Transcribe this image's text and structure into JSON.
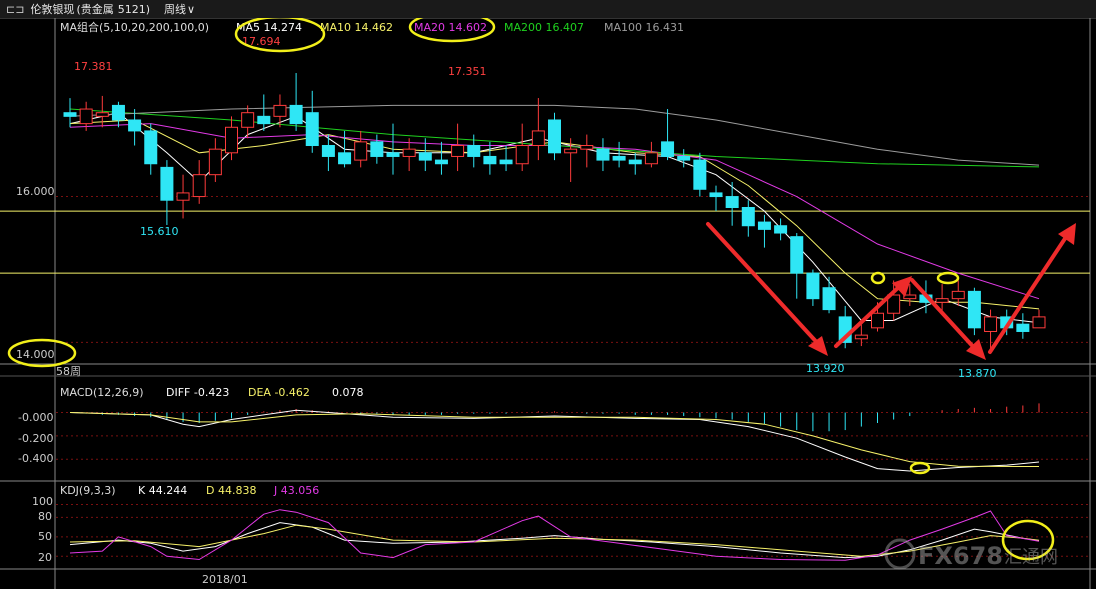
{
  "header": {
    "menu_icon": "menu-icon",
    "title": "伦敦银现",
    "category": "(贵金属",
    "code": "5121)",
    "period": "周线",
    "chevron": "∨"
  },
  "colors": {
    "up": "#ff3b3b",
    "down": "#2fe6f5",
    "ma5": "#ffffff",
    "ma10": "#f7f26a",
    "ma20": "#e23ae6",
    "ma200": "#1fd11f",
    "ma100": "#9c9c9c",
    "grid": "#7a1010",
    "hline": "#f7f26a",
    "annot": "#f2ef1a",
    "arrow": "#ee2b2b"
  },
  "price_panel": {
    "legend": {
      "group": "MA组合(5,10,20,200,100,0)",
      "ma5": "MA5 14.274",
      "ma10": "MA10 14.462",
      "ma20": "MA20 14.602",
      "ma200": "MA200 16.407",
      "ma100": "MA100 16.431"
    },
    "y_ticks": [
      "16.000",
      "14.000"
    ],
    "period_label": "58周",
    "price_labels": [
      {
        "text": "17.381",
        "color": "#ff4040"
      },
      {
        "text": "17.694",
        "color": "#ff4040"
      },
      {
        "text": "17.351",
        "color": "#ff4040"
      },
      {
        "text": "15.610",
        "color": "#2fe6f5"
      },
      {
        "text": "13.920",
        "color": "#2fe6f5"
      },
      {
        "text": "13.870",
        "color": "#2fe6f5"
      }
    ]
  },
  "macd_panel": {
    "legend": {
      "name": "MACD(12,26,9)",
      "diff": "DIFF -0.423",
      "dea": "DEA -0.462",
      "macd": "0.078"
    },
    "y_ticks": [
      "-0.000",
      "-0.200",
      "-0.400"
    ]
  },
  "kdj_panel": {
    "legend": {
      "name": "KDJ(9,3,3)",
      "k": "K 44.244",
      "d": "D 44.838",
      "j": "J 43.056"
    },
    "y_ticks": [
      "100",
      "80",
      "50",
      "20"
    ]
  },
  "x_axis": {
    "date_label": "2018/01"
  },
  "watermark": {
    "brand": "FX678",
    "site": "汇通网"
  },
  "chart_data": {
    "type": "candlestick",
    "title": "伦敦银现 周线",
    "ylim": [
      13.8,
      17.9
    ],
    "hlines": [
      15.8,
      14.95
    ],
    "candles": [
      [
        17.15,
        17.1,
        17.35,
        16.95
      ],
      [
        17.0,
        17.2,
        17.3,
        16.9
      ],
      [
        17.1,
        17.15,
        17.38,
        16.95
      ],
      [
        17.25,
        17.05,
        17.3,
        16.95
      ],
      [
        17.05,
        16.9,
        17.2,
        16.7
      ],
      [
        16.9,
        16.45,
        17.0,
        16.3
      ],
      [
        16.4,
        15.95,
        16.5,
        15.61
      ],
      [
        15.95,
        16.05,
        16.3,
        15.7
      ],
      [
        16.0,
        16.3,
        16.5,
        15.9
      ],
      [
        16.3,
        16.65,
        16.8,
        16.2
      ],
      [
        16.6,
        16.95,
        17.1,
        16.5
      ],
      [
        16.95,
        17.15,
        17.25,
        16.8
      ],
      [
        17.1,
        17.0,
        17.4,
        16.9
      ],
      [
        17.1,
        17.25,
        17.4,
        16.95
      ],
      [
        17.25,
        17.0,
        17.694,
        16.9
      ],
      [
        17.15,
        16.7,
        17.45,
        16.6
      ],
      [
        16.7,
        16.55,
        16.85,
        16.35
      ],
      [
        16.6,
        16.45,
        16.9,
        16.4
      ],
      [
        16.5,
        16.75,
        16.9,
        16.4
      ],
      [
        16.75,
        16.55,
        16.85,
        16.45
      ],
      [
        16.6,
        16.55,
        17.0,
        16.3
      ],
      [
        16.55,
        16.65,
        16.8,
        16.35
      ],
      [
        16.6,
        16.5,
        16.8,
        16.35
      ],
      [
        16.5,
        16.45,
        16.75,
        16.3
      ],
      [
        16.55,
        16.7,
        17.0,
        16.35
      ],
      [
        16.7,
        16.55,
        16.85,
        16.4
      ],
      [
        16.55,
        16.45,
        16.75,
        16.3
      ],
      [
        16.5,
        16.45,
        16.7,
        16.35
      ],
      [
        16.45,
        16.7,
        17.0,
        16.35
      ],
      [
        16.7,
        16.9,
        17.351,
        16.5
      ],
      [
        17.05,
        16.6,
        17.15,
        16.5
      ],
      [
        16.6,
        16.65,
        16.8,
        16.2
      ],
      [
        16.65,
        16.7,
        16.85,
        16.4
      ],
      [
        16.65,
        16.5,
        16.8,
        16.35
      ],
      [
        16.55,
        16.5,
        16.75,
        16.4
      ],
      [
        16.5,
        16.45,
        16.6,
        16.3
      ],
      [
        16.45,
        16.6,
        16.75,
        16.4
      ],
      [
        16.75,
        16.55,
        17.2,
        16.5
      ],
      [
        16.55,
        16.5,
        16.65,
        16.4
      ],
      [
        16.5,
        16.1,
        16.6,
        16.0
      ],
      [
        16.05,
        16.0,
        16.15,
        15.8
      ],
      [
        16.0,
        15.85,
        16.2,
        15.6
      ],
      [
        15.85,
        15.6,
        15.95,
        15.45
      ],
      [
        15.65,
        15.55,
        15.75,
        15.3
      ],
      [
        15.6,
        15.5,
        15.7,
        15.4
      ],
      [
        15.45,
        14.95,
        15.5,
        14.6
      ],
      [
        14.95,
        14.6,
        15.0,
        14.5
      ],
      [
        14.75,
        14.45,
        14.9,
        14.4
      ],
      [
        14.35,
        14.0,
        14.5,
        13.92
      ],
      [
        14.05,
        14.1,
        14.25,
        13.95
      ],
      [
        14.2,
        14.4,
        14.55,
        14.15
      ],
      [
        14.4,
        14.65,
        14.85,
        14.3
      ],
      [
        14.6,
        14.65,
        14.8,
        14.5
      ],
      [
        14.65,
        14.55,
        14.85,
        14.4
      ],
      [
        14.55,
        14.6,
        14.8,
        14.4
      ],
      [
        14.6,
        14.7,
        14.85,
        14.5
      ],
      [
        14.7,
        14.2,
        14.75,
        14.1
      ],
      [
        14.15,
        14.35,
        14.45,
        13.87
      ],
      [
        14.35,
        14.2,
        14.45,
        14.1
      ],
      [
        14.25,
        14.15,
        14.4,
        14.05
      ],
      [
        14.2,
        14.35,
        14.45,
        14.2
      ]
    ],
    "ma": {
      "MA5": [
        [
          0,
          17.0
        ],
        [
          3,
          17.15
        ],
        [
          6,
          16.6
        ],
        [
          8,
          16.2
        ],
        [
          11,
          16.85
        ],
        [
          14,
          17.1
        ],
        [
          17,
          16.65
        ],
        [
          20,
          16.6
        ],
        [
          25,
          16.6
        ],
        [
          29,
          16.8
        ],
        [
          33,
          16.6
        ],
        [
          37,
          16.55
        ],
        [
          40,
          16.3
        ],
        [
          43,
          15.8
        ],
        [
          46,
          15.1
        ],
        [
          49,
          14.3
        ],
        [
          51,
          14.3
        ],
        [
          54,
          14.6
        ],
        [
          57,
          14.35
        ],
        [
          60,
          14.27
        ]
      ],
      "MA10": [
        [
          0,
          17.0
        ],
        [
          4,
          17.05
        ],
        [
          8,
          16.6
        ],
        [
          12,
          16.7
        ],
        [
          16,
          16.85
        ],
        [
          20,
          16.65
        ],
        [
          25,
          16.6
        ],
        [
          30,
          16.75
        ],
        [
          35,
          16.6
        ],
        [
          39,
          16.55
        ],
        [
          42,
          16.15
        ],
        [
          45,
          15.6
        ],
        [
          48,
          14.95
        ],
        [
          50,
          14.6
        ],
        [
          53,
          14.55
        ],
        [
          56,
          14.55
        ],
        [
          60,
          14.46
        ]
      ],
      "MA20": [
        [
          0,
          16.95
        ],
        [
          5,
          17.0
        ],
        [
          10,
          16.8
        ],
        [
          15,
          16.85
        ],
        [
          20,
          16.75
        ],
        [
          25,
          16.7
        ],
        [
          30,
          16.7
        ],
        [
          35,
          16.65
        ],
        [
          40,
          16.5
        ],
        [
          45,
          16.0
        ],
        [
          50,
          15.35
        ],
        [
          55,
          14.95
        ],
        [
          60,
          14.6
        ]
      ],
      "MA200": [
        [
          0,
          17.2
        ],
        [
          10,
          17.05
        ],
        [
          20,
          16.85
        ],
        [
          30,
          16.7
        ],
        [
          40,
          16.55
        ],
        [
          50,
          16.45
        ],
        [
          60,
          16.407
        ]
      ],
      "MA100": [
        [
          0,
          17.1
        ],
        [
          10,
          17.2
        ],
        [
          20,
          17.25
        ],
        [
          30,
          17.25
        ],
        [
          35,
          17.2
        ],
        [
          40,
          17.05
        ],
        [
          45,
          16.85
        ],
        [
          50,
          16.65
        ],
        [
          55,
          16.5
        ],
        [
          60,
          16.431
        ]
      ]
    },
    "macd": {
      "ylim": [
        -0.56,
        0.09
      ],
      "diff": [
        [
          0,
          0.0
        ],
        [
          5,
          -0.02
        ],
        [
          7,
          -0.1
        ],
        [
          8,
          -0.12
        ],
        [
          10,
          -0.06
        ],
        [
          14,
          0.02
        ],
        [
          16,
          0.0
        ],
        [
          20,
          -0.04
        ],
        [
          25,
          -0.05
        ],
        [
          30,
          -0.03
        ],
        [
          35,
          -0.05
        ],
        [
          39,
          -0.06
        ],
        [
          42,
          -0.12
        ],
        [
          45,
          -0.22
        ],
        [
          48,
          -0.38
        ],
        [
          50,
          -0.48
        ],
        [
          52,
          -0.5
        ],
        [
          55,
          -0.47
        ],
        [
          58,
          -0.45
        ],
        [
          60,
          -0.423
        ]
      ],
      "dea": [
        [
          0,
          0.0
        ],
        [
          5,
          -0.02
        ],
        [
          8,
          -0.08
        ],
        [
          10,
          -0.08
        ],
        [
          14,
          -0.02
        ],
        [
          18,
          -0.01
        ],
        [
          25,
          -0.04
        ],
        [
          30,
          -0.04
        ],
        [
          35,
          -0.04
        ],
        [
          40,
          -0.06
        ],
        [
          43,
          -0.1
        ],
        [
          46,
          -0.2
        ],
        [
          49,
          -0.32
        ],
        [
          52,
          -0.42
        ],
        [
          55,
          -0.46
        ],
        [
          60,
          -0.462
        ]
      ],
      "hist": [
        0.0,
        -0.01,
        -0.02,
        -0.02,
        -0.03,
        -0.04,
        -0.06,
        -0.08,
        -0.09,
        -0.07,
        -0.05,
        -0.02,
        0.01,
        0.02,
        0.03,
        0.02,
        0.01,
        0.0,
        -0.01,
        -0.01,
        -0.02,
        -0.02,
        -0.02,
        -0.02,
        -0.01,
        -0.01,
        -0.01,
        -0.01,
        0.0,
        0.01,
        0.01,
        0.0,
        -0.01,
        -0.01,
        -0.01,
        -0.02,
        -0.02,
        -0.02,
        -0.03,
        -0.04,
        -0.05,
        -0.06,
        -0.08,
        -0.1,
        -0.12,
        -0.15,
        -0.16,
        -0.16,
        -0.15,
        -0.12,
        -0.09,
        -0.06,
        -0.03,
        0.0,
        0.02,
        0.03,
        0.04,
        0.03,
        0.05,
        0.06,
        0.078
      ]
    },
    "kdj": {
      "ylim": [
        5,
        110
      ],
      "K": [
        [
          0,
          38
        ],
        [
          3,
          45
        ],
        [
          5,
          40
        ],
        [
          7,
          28
        ],
        [
          9,
          35
        ],
        [
          11,
          55
        ],
        [
          13,
          72
        ],
        [
          15,
          65
        ],
        [
          17,
          45
        ],
        [
          20,
          40
        ],
        [
          24,
          42
        ],
        [
          28,
          48
        ],
        [
          30,
          52
        ],
        [
          33,
          46
        ],
        [
          36,
          42
        ],
        [
          40,
          35
        ],
        [
          44,
          25
        ],
        [
          48,
          18
        ],
        [
          50,
          20
        ],
        [
          52,
          30
        ],
        [
          54,
          45
        ],
        [
          56,
          62
        ],
        [
          57,
          58
        ],
        [
          59,
          48
        ],
        [
          60,
          44.2
        ]
      ],
      "D": [
        [
          0,
          42
        ],
        [
          4,
          44
        ],
        [
          8,
          35
        ],
        [
          12,
          55
        ],
        [
          14,
          68
        ],
        [
          16,
          62
        ],
        [
          20,
          45
        ],
        [
          25,
          42
        ],
        [
          30,
          48
        ],
        [
          35,
          45
        ],
        [
          40,
          38
        ],
        [
          45,
          28
        ],
        [
          49,
          20
        ],
        [
          52,
          28
        ],
        [
          55,
          42
        ],
        [
          57,
          52
        ],
        [
          59,
          48
        ],
        [
          60,
          44.8
        ]
      ],
      "J": [
        [
          0,
          25
        ],
        [
          2,
          28
        ],
        [
          3,
          50
        ],
        [
          5,
          35
        ],
        [
          6,
          20
        ],
        [
          8,
          15
        ],
        [
          10,
          45
        ],
        [
          12,
          85
        ],
        [
          13,
          92
        ],
        [
          14,
          88
        ],
        [
          16,
          72
        ],
        [
          18,
          25
        ],
        [
          20,
          18
        ],
        [
          22,
          38
        ],
        [
          25,
          42
        ],
        [
          28,
          75
        ],
        [
          29,
          82
        ],
        [
          31,
          50
        ],
        [
          34,
          40
        ],
        [
          37,
          30
        ],
        [
          40,
          20
        ],
        [
          44,
          15
        ],
        [
          48,
          14
        ],
        [
          50,
          22
        ],
        [
          52,
          45
        ],
        [
          54,
          62
        ],
        [
          56,
          80
        ],
        [
          57,
          90
        ],
        [
          58,
          52
        ],
        [
          60,
          43.1
        ]
      ]
    }
  }
}
